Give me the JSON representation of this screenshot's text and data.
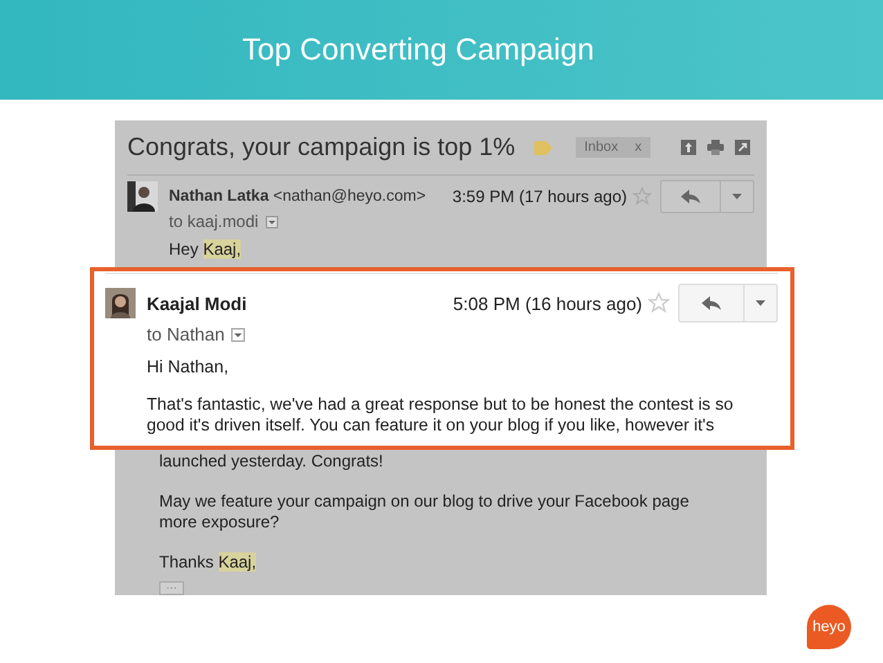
{
  "slide_title": "Top Converting Campaign",
  "email": {
    "subject": "Congrats, your campaign is top 1%",
    "label": "Inbox",
    "label_close": "x",
    "first_message": {
      "sender": "Nathan Latka",
      "address": "<nathan@heyo.com>",
      "time": "3:59 PM (17 hours ago)",
      "recipient": "to kaaj.modi",
      "greeting": "Hey",
      "greeting_name": "Kaaj,"
    },
    "body_lines": [
      "launched yesterday. Congrats!",
      "May we feature your campaign on our blog to drive your Facebook page more exposure?"
    ],
    "signoff": "Thanks",
    "signoff_name": "Kaaj,",
    "more_button": "···"
  },
  "highlighted_message": {
    "sender": "Kaajal Modi",
    "time": "5:08 PM (16 hours ago)",
    "recipient": "to Nathan",
    "greeting": "Hi Nathan,",
    "paragraph_lines": [
      "That's fantastic, we've had a great response but to be honest the contest is so",
      "good it's driven itself. You can feature it on your blog if you like, however it's"
    ]
  },
  "logo": "heyo"
}
